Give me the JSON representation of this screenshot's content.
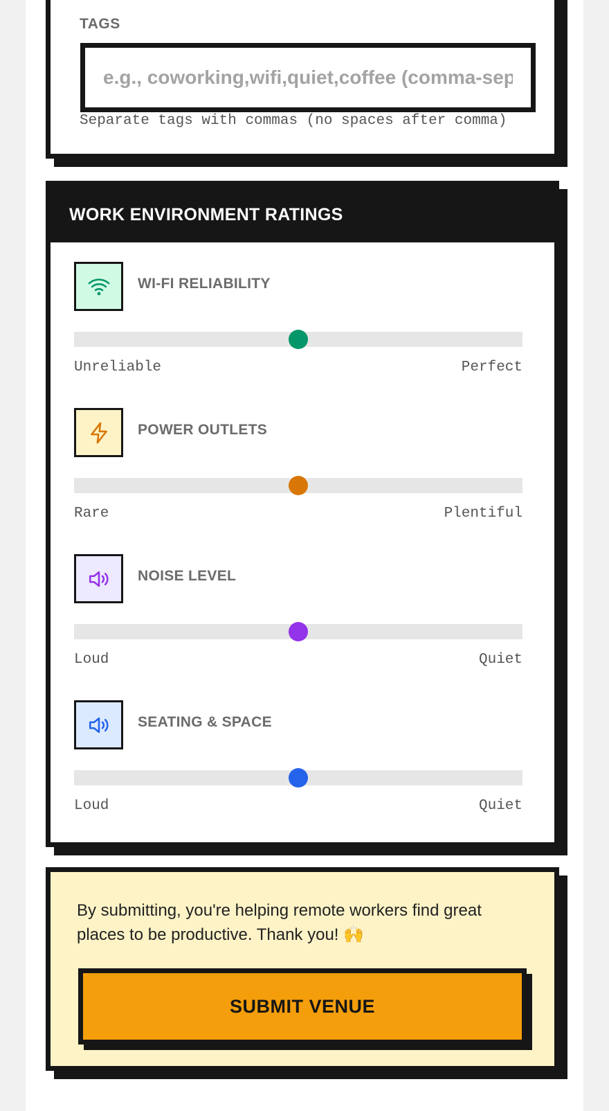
{
  "tags": {
    "label": "TAGS",
    "placeholder": "e.g., coworking,wifi,quiet,coffee (comma-separated)",
    "value": "",
    "hint": "Separate tags with commas (no spaces after comma)"
  },
  "ratings": {
    "header": "WORK ENVIRONMENT RATINGS",
    "items": [
      {
        "icon": "wifi-icon",
        "title": "WI-FI RELIABILITY",
        "min_label": "Unreliable",
        "max_label": "Perfect",
        "value_fraction": 0.5,
        "color": "#059669",
        "icon_bg": "#d1fae5"
      },
      {
        "icon": "lightning-bolt-icon",
        "title": "POWER OUTLETS",
        "min_label": "Rare",
        "max_label": "Plentiful",
        "value_fraction": 0.5,
        "color": "#d97706",
        "icon_bg": "#fef3c7"
      },
      {
        "icon": "speaker-icon",
        "title": "NOISE LEVEL",
        "min_label": "Loud",
        "max_label": "Quiet",
        "value_fraction": 0.5,
        "color": "#9333ea",
        "icon_bg": "#ede9fe"
      },
      {
        "icon": "speaker-icon",
        "title": "SEATING & SPACE",
        "min_label": "Loud",
        "max_label": "Quiet",
        "value_fraction": 0.5,
        "color": "#2563eb",
        "icon_bg": "#dbeafe"
      }
    ]
  },
  "submit": {
    "message": "By submitting, you're helping remote workers find great places to be productive. Thank you! 🙌",
    "button_label": "SUBMIT VENUE",
    "accent": "#f59e0b",
    "panel_bg": "#fef3c7"
  }
}
